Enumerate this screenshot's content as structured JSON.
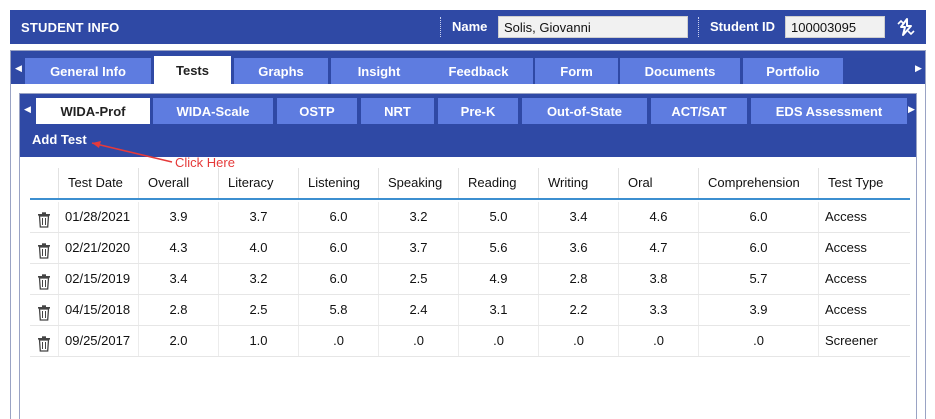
{
  "header": {
    "title": "STUDENT INFO",
    "name_label": "Name",
    "name_value": "Solis, Giovanni",
    "student_id_label": "Student ID",
    "student_id_value": "100003095"
  },
  "main_tabs": [
    {
      "label": "General Info",
      "active": false
    },
    {
      "label": "Tests",
      "active": true
    },
    {
      "label": "Graphs",
      "active": false
    },
    {
      "label": "Insight",
      "active": false
    },
    {
      "label": "Feedback",
      "active": false
    },
    {
      "label": "Form",
      "active": false
    },
    {
      "label": "Documents",
      "active": false
    },
    {
      "label": "Portfolio",
      "active": false
    }
  ],
  "sub_tabs": [
    {
      "label": "WIDA-Prof",
      "active": true
    },
    {
      "label": "WIDA-Scale",
      "active": false
    },
    {
      "label": "OSTP",
      "active": false
    },
    {
      "label": "NRT",
      "active": false
    },
    {
      "label": "Pre-K",
      "active": false
    },
    {
      "label": "Out-of-State",
      "active": false
    },
    {
      "label": "ACT/SAT",
      "active": false
    },
    {
      "label": "EDS Assessment",
      "active": false
    }
  ],
  "add_test_label": "Add Test",
  "annotation": "Click Here",
  "table": {
    "columns": [
      "Test Date",
      "Overall",
      "Literacy",
      "Listening",
      "Speaking",
      "Reading",
      "Writing",
      "Oral",
      "Comprehension",
      "Test Type"
    ],
    "rows": [
      [
        "01/28/2021",
        "3.9",
        "3.7",
        "6.0",
        "3.2",
        "5.0",
        "3.4",
        "4.6",
        "6.0",
        "Access"
      ],
      [
        "02/21/2020",
        "4.3",
        "4.0",
        "6.0",
        "3.7",
        "5.6",
        "3.6",
        "4.7",
        "6.0",
        "Access"
      ],
      [
        "02/15/2019",
        "3.4",
        "3.2",
        "6.0",
        "2.5",
        "4.9",
        "2.8",
        "3.8",
        "5.7",
        "Access"
      ],
      [
        "04/15/2018",
        "2.8",
        "2.5",
        "5.8",
        "2.4",
        "3.1",
        "2.2",
        "3.3",
        "3.9",
        "Access"
      ],
      [
        "09/25/2017",
        "2.0",
        "1.0",
        ".0",
        ".0",
        ".0",
        ".0",
        ".0",
        ".0",
        "Screener"
      ]
    ]
  },
  "colors": {
    "primary": "#2f49a5",
    "tab": "#5e7ce0",
    "accent_line": "#3c8fd0",
    "annotation": "#e53a3a"
  }
}
